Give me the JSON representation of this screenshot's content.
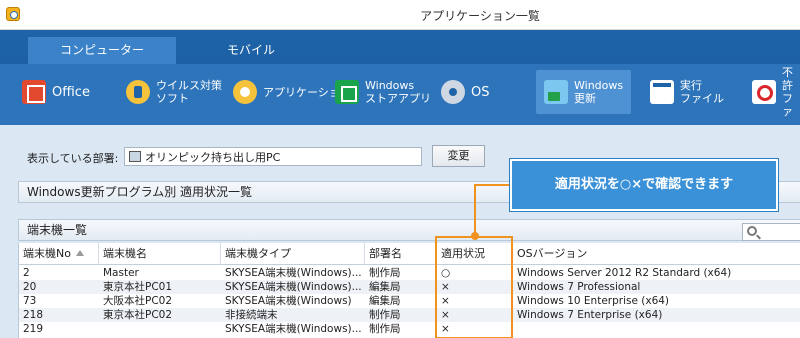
{
  "window": {
    "title": "アプリケーション一覧"
  },
  "ribbon": {
    "tabs": [
      {
        "label": "コンピューター",
        "active": true
      },
      {
        "label": "モバイル",
        "active": false
      }
    ],
    "tools": [
      {
        "label": "Office",
        "icon": "office-icon"
      },
      {
        "label": "ウイルス対策\nソフト",
        "icon": "antivirus-icon"
      },
      {
        "label": "アプリケーション",
        "icon": "application-icon"
      },
      {
        "label": "Windows\nストアアプリ",
        "icon": "store-app-icon"
      },
      {
        "label": "OS",
        "icon": "os-icon"
      },
      {
        "label": "Windows\n更新",
        "icon": "windows-update-icon",
        "selected": true
      },
      {
        "label": "実行\nファイル",
        "icon": "executable-icon"
      },
      {
        "label": "不許\nファ",
        "icon": "forbidden-icon"
      }
    ]
  },
  "department": {
    "label": "表示している部署:",
    "value": "オリンピック持ち出し用PC",
    "change_button": "変更"
  },
  "sections": {
    "update_status": "Windows更新プログラム別 適用状況一覧",
    "terminal_list": "端末機一覧"
  },
  "table": {
    "headers": [
      "端末機No",
      "端末機名",
      "端末機タイプ",
      "部署名",
      "適用状況",
      "OSバージョン"
    ],
    "rows": [
      [
        "2",
        "Master",
        "SKYSEA端末機(Windows)...",
        "制作局",
        "○",
        "Windows Server 2012 R2 Standard (x64)"
      ],
      [
        "20",
        "東京本社PC01",
        "SKYSEA端末機(Windows)...",
        "編集局",
        "×",
        "Windows 7 Professional"
      ],
      [
        "73",
        "大阪本社PC02",
        "SKYSEA端末機(Windows)",
        "編集局",
        "×",
        "Windows 10 Enterprise (x64)"
      ],
      [
        "218",
        "東京本社PC02",
        "非接続端末",
        "制作局",
        "×",
        "Windows 7 Enterprise (x64)"
      ],
      [
        "219",
        "",
        "SKYSEA端末機(Windows)...",
        "制作局",
        "×",
        ""
      ]
    ]
  },
  "callout": {
    "text": "適用状況を○×で確認できます"
  },
  "colors": {
    "ribbon": "#1e63a8",
    "toolbar": "#2d74bb",
    "highlight": "#f0921e",
    "callout": "#3a91d8"
  }
}
